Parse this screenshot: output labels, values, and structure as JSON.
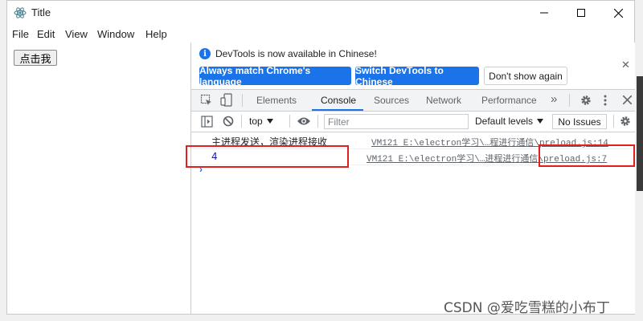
{
  "window": {
    "title": "Title",
    "menu": [
      "File",
      "Edit",
      "View",
      "Window",
      "Help"
    ]
  },
  "app": {
    "button_label": "点击我"
  },
  "devtools": {
    "infobar": {
      "message": "DevTools is now available in Chinese!",
      "buttons": [
        "Always match Chrome's language",
        "Switch DevTools to Chinese",
        "Don't show again"
      ]
    },
    "tabs": [
      "Elements",
      "Console",
      "Sources",
      "Network",
      "Performance"
    ],
    "active_tab": "Console",
    "more_tabs": "»",
    "console": {
      "context": "top",
      "filter_placeholder": "Filter",
      "levels": "Default levels",
      "issues": "No Issues",
      "rows": [
        {
          "message": "主进程发送，渲染进程接收",
          "source": "VM121 E:\\electron学习\\…程进行通信\\preload.js:14"
        },
        {
          "message": "4",
          "source_prefix": "VM121 E:\\electron学习\\…进程进行通信",
          "source_highlight": "\\preload.js:7"
        }
      ],
      "prompt": "›"
    }
  },
  "watermark": "CSDN @爱吃雪糕的小布丁"
}
